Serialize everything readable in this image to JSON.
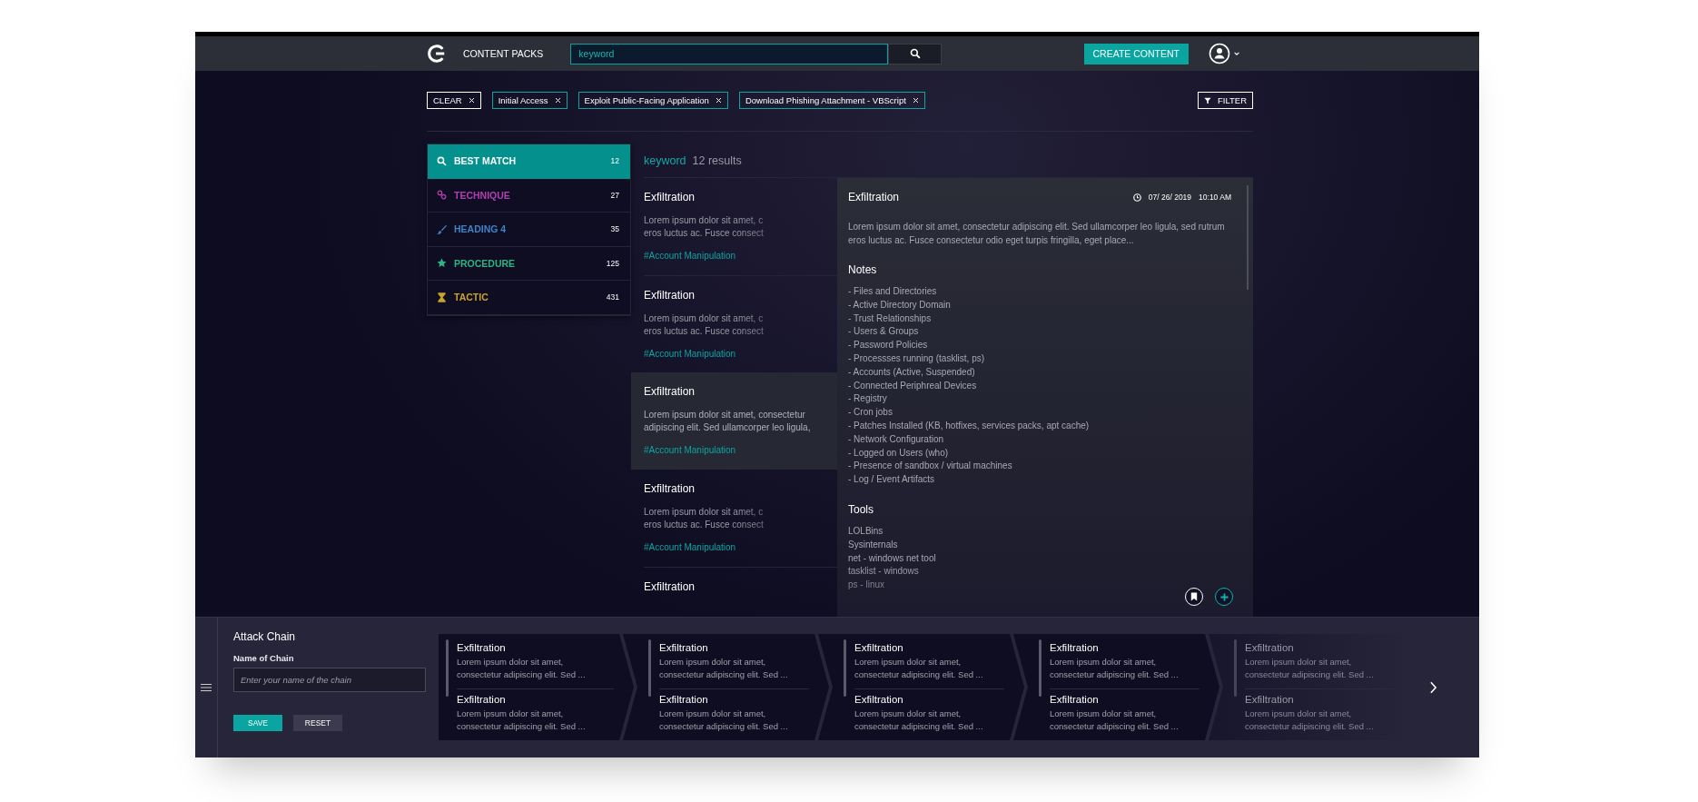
{
  "topbar": {
    "title": "CONTENT PACKS",
    "search": {
      "value": "keyword"
    },
    "create_button": "CREATE CONTENT"
  },
  "filters": [
    {
      "label": "CLEAR",
      "kind": "clear"
    },
    {
      "label": "Initial Access",
      "kind": "tag"
    },
    {
      "label": "Exploit Public-Facing Application",
      "kind": "tag"
    },
    {
      "label": "Download Phishing Attachment - VBScript",
      "kind": "tag"
    }
  ],
  "filter_button": "FILTER",
  "categories": [
    {
      "label": "BEST MATCH",
      "count": "12",
      "kind": "search",
      "color": "#ffffff",
      "selected": true
    },
    {
      "label": "TECHNIQUE",
      "count": "27",
      "kind": "link",
      "color": "#b33fb3",
      "selected": false
    },
    {
      "label": "HEADING 4",
      "count": "35",
      "kind": "brush",
      "color": "#3d84c6",
      "selected": false
    },
    {
      "label": "PROCEDURE",
      "count": "125",
      "kind": "star",
      "color": "#2eb383",
      "selected": false
    },
    {
      "label": "TACTIC",
      "count": "431",
      "kind": "hourglass",
      "color": "#c9a32e",
      "selected": false
    }
  ],
  "results": {
    "query": "keyword",
    "count": "12 results",
    "items": [
      {
        "title": "Exfiltration",
        "description": "Lorem ipsum dolor sit amet, c\neros luctus ac. Fusce consect",
        "tag": "#Account Manipulation",
        "selected": false
      },
      {
        "title": "Exfiltration",
        "description": "Lorem ipsum dolor sit amet, c\neros luctus ac. Fusce consect",
        "tag": "#Account Manipulation",
        "selected": false
      },
      {
        "title": "Exfiltration",
        "description": "Lorem ipsum dolor sit amet, consectetur\nadipiscing elit. Sed ullamcorper leo ligula,",
        "tag": "#Account Manipulation",
        "selected": true
      },
      {
        "title": "Exfiltration",
        "description": "Lorem ipsum dolor sit amet, c\neros luctus ac. Fusce consect",
        "tag": "#Account Manipulation",
        "selected": false
      },
      {
        "title": "Exfiltration",
        "selected": false
      }
    ]
  },
  "detail": {
    "title": "Exfiltration",
    "date": "07/ 26/ 2019",
    "time": "10:10 AM",
    "description": "Lorem ipsum dolor sit amet, consectetur adipiscing elit. Sed ullamcorper leo ligula, sed rutrum eros luctus ac. Fusce consectetur odio eget turpis fringilla, eget place...",
    "notes_heading": "Notes",
    "notes": [
      "- Files and Directories",
      "- Active Directory Domain",
      "- Trust Relationships",
      "- Users & Groups",
      "- Password Policies",
      "- Processses running (tasklist, ps)",
      "- Accounts (Active, Suspended)",
      "- Connected Periphreal Devices",
      "- Registry",
      "- Cron jobs",
      "- Patches Installed (KB, hotfixes, services packs, apt cache)",
      "- Network Configuration",
      "- Logged on Users (who)",
      "- Presence of sandbox / virtual machines",
      "- Log / Event Artifacts"
    ],
    "tools_heading": "Tools",
    "tools": [
      "LOLBins",
      "Sysinternals",
      "net - windows net tool",
      "tasklist - windows",
      "ps - linux"
    ]
  },
  "chain": {
    "title": "Attack Chain",
    "name_label": "Name of Chain",
    "name_field": {
      "placeholder": "Enter your name of the chain"
    },
    "save_button": "SAVE",
    "reset_button": "RESET",
    "cards": [
      {
        "dimmed": false,
        "steps": [
          {
            "title": "Exfiltration",
            "description": "Lorem ipsum dolor sit amet,\nconsectetur adipiscing elit. Sed ..."
          },
          {
            "title": "Exfiltration",
            "description": "Lorem ipsum dolor sit amet,\nconsectetur adipiscing elit. Sed ..."
          }
        ]
      },
      {
        "dimmed": false,
        "steps": [
          {
            "title": "Exfiltration",
            "description": "Lorem ipsum dolor sit amet,\nconsectetur adipiscing elit. Sed ..."
          },
          {
            "title": "Exfiltration",
            "description": "Lorem ipsum dolor sit amet,\nconsectetur adipiscing elit. Sed ..."
          }
        ]
      },
      {
        "dimmed": false,
        "steps": [
          {
            "title": "Exfiltration",
            "description": "Lorem ipsum dolor sit amet,\nconsectetur adipiscing elit. Sed ..."
          },
          {
            "title": "Exfiltration",
            "description": "Lorem ipsum dolor sit amet,\nconsectetur adipiscing elit. Sed ..."
          }
        ]
      },
      {
        "dimmed": false,
        "steps": [
          {
            "title": "Exfiltration",
            "description": "Lorem ipsum dolor sit amet,\nconsectetur adipiscing elit. Sed ..."
          },
          {
            "title": "Exfiltration",
            "description": "Lorem ipsum dolor sit amet,\nconsectetur adipiscing elit. Sed ..."
          }
        ]
      },
      {
        "dimmed": true,
        "steps": [
          {
            "title": "Exfiltration",
            "description": "Lorem ipsum dolor sit amet,\nconsectetur adipiscing elit. Sed ..."
          },
          {
            "title": "Exfiltration",
            "description": "Lorem ipsum dolor sit amet,\nconsectetur adipiscing elit. Sed ..."
          }
        ]
      }
    ]
  }
}
